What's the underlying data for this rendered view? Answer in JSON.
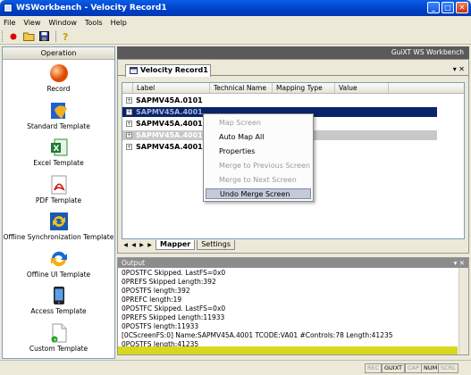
{
  "window": {
    "title": "WSWorkbench - Velocity Record1"
  },
  "menu": [
    "File",
    "View",
    "Window",
    "Tools",
    "Help"
  ],
  "toolbar": {
    "icons": [
      "record-dot-icon",
      "open-folder-icon",
      "save-disk-icon",
      "help-icon"
    ]
  },
  "left_panel": {
    "header": "Operation",
    "items": [
      {
        "label": "Record",
        "icon": "record-orb-icon"
      },
      {
        "label": "Standard Template",
        "icon": "standard-template-icon"
      },
      {
        "label": "Excel Template",
        "icon": "excel-icon"
      },
      {
        "label": "PDF Template",
        "icon": "pdf-icon"
      },
      {
        "label": "Offline Synchronization Template",
        "icon": "sync-icon"
      },
      {
        "label": "Offline UI Template",
        "icon": "offline-ui-icon"
      },
      {
        "label": "Access Template",
        "icon": "mobile-device-icon"
      },
      {
        "label": "Custom Template",
        "icon": "custom-template-icon"
      }
    ]
  },
  "right_strip": {
    "text": "GuiXT WS Workbench"
  },
  "document": {
    "tab_label": "Velocity Record1",
    "tab_controls": "▾ ✕",
    "columns": [
      "Label",
      "Technical Name",
      "Mapping Type",
      "Value"
    ],
    "rows": [
      {
        "label": "SAPMV45A.0101",
        "state": "normal"
      },
      {
        "label": "SAPMV45A.4001",
        "state": "selected"
      },
      {
        "label": "SAPMV45A.4001",
        "state": "normal"
      },
      {
        "label": "SAPMV45A.4001",
        "state": "gray"
      },
      {
        "label": "SAPMV45A.4001",
        "state": "normal"
      }
    ],
    "subtabs": [
      "Mapper",
      "Settings"
    ]
  },
  "context_menu": [
    {
      "label": "Map Screen",
      "enabled": false
    },
    {
      "label": "Auto Map All",
      "enabled": true
    },
    {
      "label": "Properties",
      "enabled": true
    },
    {
      "label": "Merge to Previous Screen",
      "enabled": false
    },
    {
      "label": "Merge to Next Screen",
      "enabled": false
    },
    {
      "label": "Undo Merge Screen",
      "enabled": true,
      "highlighted": true
    }
  ],
  "output": {
    "title": "Output",
    "controls": "▾ ✕",
    "lines": [
      "0POSTFC Skipped. LastFS=0x0",
      "0PREFS Skipped Length:392",
      "0POSTFS length:392",
      "0PREFC length:19",
      "0POSTFC Skipped. LastFS=0x0",
      "0PREFS Skipped Length:11933",
      "0POSTFS length:11933",
      "[0CScreenFS:0] Name:SAPMV45A.4001 TCODE:VA01 #Controls:78 Length:41235",
      "0POSTFS length:41235"
    ]
  },
  "status_indicators": [
    {
      "label": "REC",
      "active": false
    },
    {
      "label": "GUIXT",
      "active": true
    },
    {
      "label": "CAP",
      "active": false
    },
    {
      "label": "NUM",
      "active": true
    },
    {
      "label": "SCRL",
      "active": false
    }
  ],
  "colors": {
    "title_bar": "#0040c8",
    "selection": "#0a246a",
    "output_bar": "#d8d820",
    "right_strip": "#5a5a5a"
  }
}
